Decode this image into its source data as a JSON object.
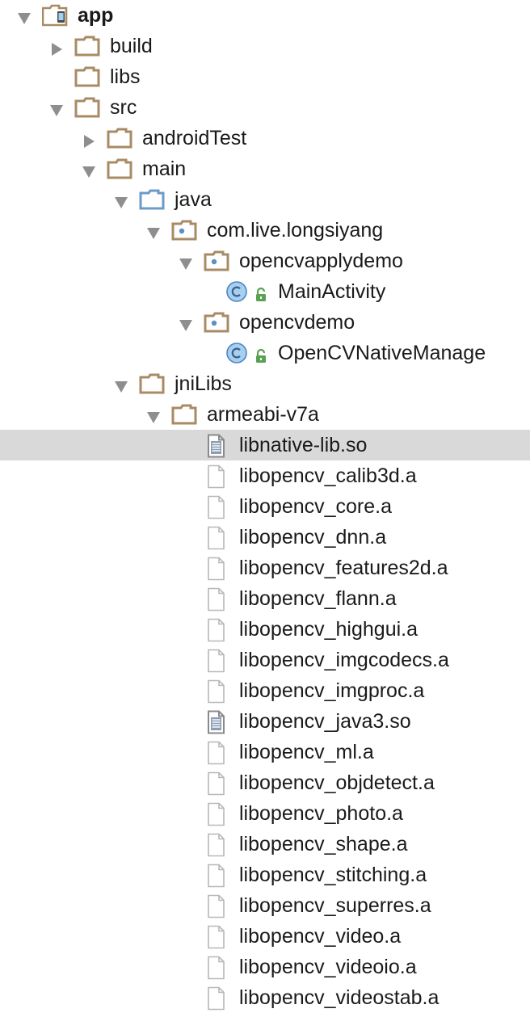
{
  "project_tree": {
    "items": [
      {
        "name": "app",
        "kind": "module",
        "expanded": true,
        "depth": 0,
        "bold": true
      },
      {
        "name": "build",
        "kind": "folder",
        "expanded": false,
        "depth": 1
      },
      {
        "name": "libs",
        "kind": "folder",
        "expanded": null,
        "depth": 1
      },
      {
        "name": "src",
        "kind": "folder",
        "expanded": true,
        "depth": 1
      },
      {
        "name": "androidTest",
        "kind": "folder",
        "expanded": false,
        "depth": 2
      },
      {
        "name": "main",
        "kind": "folder",
        "expanded": true,
        "depth": 2
      },
      {
        "name": "java",
        "kind": "source-folder",
        "expanded": true,
        "depth": 3
      },
      {
        "name": "com.live.longsiyang",
        "kind": "package",
        "expanded": true,
        "depth": 4
      },
      {
        "name": "opencvapplydemo",
        "kind": "package",
        "expanded": true,
        "depth": 5
      },
      {
        "name": "MainActivity",
        "kind": "class",
        "expanded": null,
        "depth": 6
      },
      {
        "name": "opencvdemo",
        "kind": "package",
        "expanded": true,
        "depth": 5
      },
      {
        "name": "OpenCVNativeManage",
        "kind": "class",
        "expanded": null,
        "depth": 6
      },
      {
        "name": "jniLibs",
        "kind": "folder",
        "expanded": true,
        "depth": 3
      },
      {
        "name": "armeabi-v7a",
        "kind": "folder",
        "expanded": true,
        "depth": 4
      },
      {
        "name": "libnative-lib.so",
        "kind": "text-file",
        "expanded": null,
        "depth": 5,
        "selected": true
      },
      {
        "name": "libopencv_calib3d.a",
        "kind": "file",
        "expanded": null,
        "depth": 5
      },
      {
        "name": "libopencv_core.a",
        "kind": "file",
        "expanded": null,
        "depth": 5
      },
      {
        "name": "libopencv_dnn.a",
        "kind": "file",
        "expanded": null,
        "depth": 5
      },
      {
        "name": "libopencv_features2d.a",
        "kind": "file",
        "expanded": null,
        "depth": 5
      },
      {
        "name": "libopencv_flann.a",
        "kind": "file",
        "expanded": null,
        "depth": 5
      },
      {
        "name": "libopencv_highgui.a",
        "kind": "file",
        "expanded": null,
        "depth": 5
      },
      {
        "name": "libopencv_imgcodecs.a",
        "kind": "file",
        "expanded": null,
        "depth": 5
      },
      {
        "name": "libopencv_imgproc.a",
        "kind": "file",
        "expanded": null,
        "depth": 5
      },
      {
        "name": "libopencv_java3.so",
        "kind": "text-file",
        "expanded": null,
        "depth": 5
      },
      {
        "name": "libopencv_ml.a",
        "kind": "file",
        "expanded": null,
        "depth": 5
      },
      {
        "name": "libopencv_objdetect.a",
        "kind": "file",
        "expanded": null,
        "depth": 5
      },
      {
        "name": "libopencv_photo.a",
        "kind": "file",
        "expanded": null,
        "depth": 5
      },
      {
        "name": "libopencv_shape.a",
        "kind": "file",
        "expanded": null,
        "depth": 5
      },
      {
        "name": "libopencv_stitching.a",
        "kind": "file",
        "expanded": null,
        "depth": 5
      },
      {
        "name": "libopencv_superres.a",
        "kind": "file",
        "expanded": null,
        "depth": 5
      },
      {
        "name": "libopencv_video.a",
        "kind": "file",
        "expanded": null,
        "depth": 5
      },
      {
        "name": "libopencv_videoio.a",
        "kind": "file",
        "expanded": null,
        "depth": 5
      },
      {
        "name": "libopencv_videostab.a",
        "kind": "file",
        "expanded": null,
        "depth": 5
      }
    ]
  },
  "colors": {
    "folder": "#a88b64",
    "source_folder": "#6b9bc7",
    "package_dot": "#5f8fc0",
    "class_fill": "#a7cff0",
    "class_stroke": "#4b86c4",
    "access_lock": "#5aa152",
    "arrow": "#8e8e8e",
    "selection": "#d9d9d9",
    "file_outline": "#b8b8b8",
    "text_file_fill": "#8a9db5"
  },
  "icons": {
    "module": "android-module-icon",
    "folder": "folder-icon",
    "source-folder": "source-folder-icon",
    "package": "package-icon",
    "class": "class-icon",
    "text-file": "text-file-icon",
    "file": "file-icon"
  }
}
